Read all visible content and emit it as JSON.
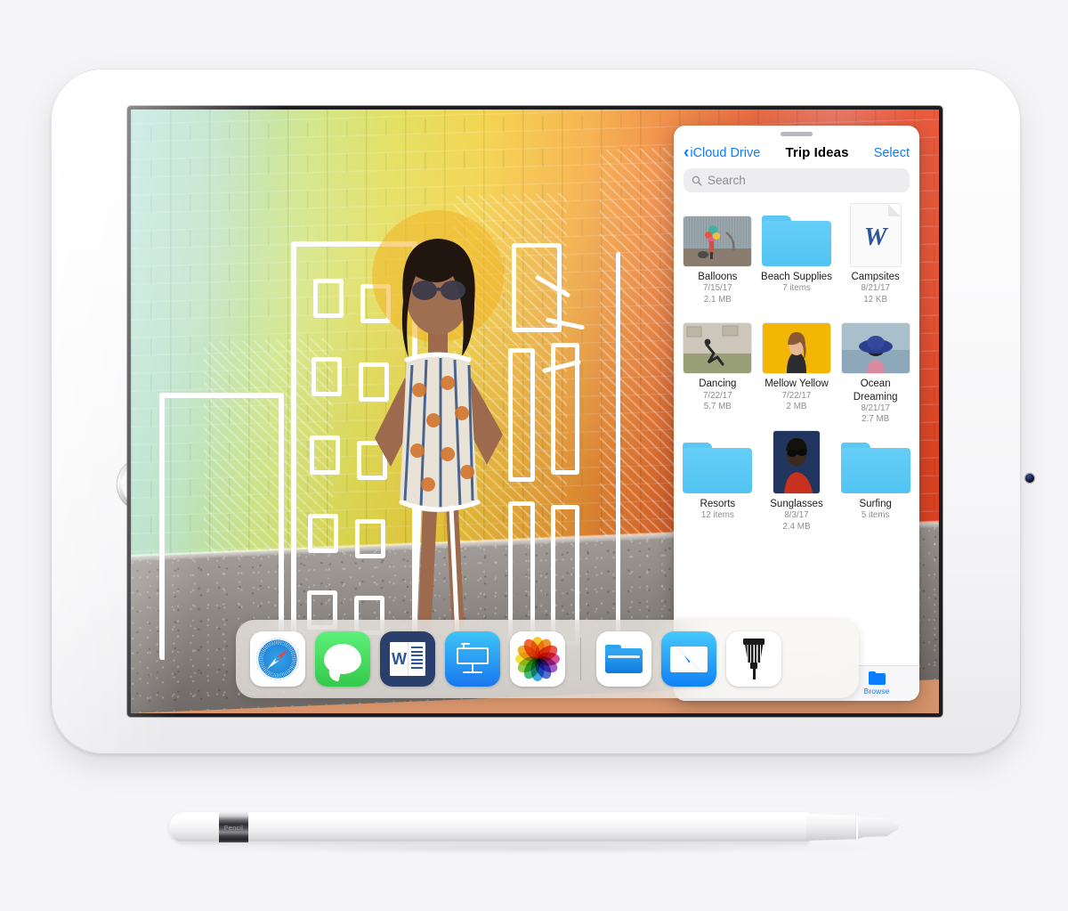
{
  "device": {
    "name": "iPad",
    "color": "Silver",
    "home_button": "home-button",
    "front_camera": "front-camera",
    "accessory": "Apple Pencil",
    "pencil_band_text": "Pencil"
  },
  "wallpaper": {
    "description": "Painted brick wall mural with white marker city drawing and woman standing",
    "gradient": [
      "#9fd9cf",
      "#cfe47f",
      "#f2cf3a",
      "#f5a93a",
      "#ef7d33",
      "#e8592c",
      "#e0421f"
    ],
    "ground_color": "#89837f",
    "marker_color": "#ffffff"
  },
  "files_app": {
    "back_label": "iCloud Drive",
    "back_icon": "chevron-left-icon",
    "title": "Trip Ideas",
    "select_label": "Select",
    "accent_color": "#0a7cff",
    "search": {
      "placeholder": "Search",
      "icon": "search-icon"
    },
    "items": [
      {
        "name": "Balloons",
        "kind": "photo",
        "date": "7/15/17",
        "size": "2.1 MB",
        "meta2": ""
      },
      {
        "name": "Beach Supplies",
        "kind": "folder",
        "date": "",
        "size": "",
        "meta2": "7 items"
      },
      {
        "name": "Campsites",
        "kind": "doc",
        "date": "8/21/17",
        "size": "12 KB",
        "meta2": "",
        "glyph": "W"
      },
      {
        "name": "Dancing",
        "kind": "photo",
        "date": "7/22/17",
        "size": "5.7 MB",
        "meta2": ""
      },
      {
        "name": "Mellow Yellow",
        "kind": "photo",
        "date": "7/22/17",
        "size": "2 MB",
        "meta2": ""
      },
      {
        "name": "Ocean Dreaming",
        "kind": "photo",
        "date": "8/21/17",
        "size": "2.7 MB",
        "meta2": ""
      },
      {
        "name": "Resorts",
        "kind": "folder",
        "date": "",
        "size": "",
        "meta2": "12 items"
      },
      {
        "name": "Sunglasses",
        "kind": "photo",
        "date": "8/3/17",
        "size": "2.4 MB",
        "meta2": ""
      },
      {
        "name": "Surfing",
        "kind": "folder",
        "date": "",
        "size": "",
        "meta2": "5 items"
      }
    ],
    "tabbar": {
      "browse_label": "Browse",
      "browse_icon": "folder-icon"
    }
  },
  "dock": {
    "apps": [
      {
        "label": "Safari",
        "icon": "safari-icon"
      },
      {
        "label": "Messages",
        "icon": "messages-icon"
      },
      {
        "label": "Word",
        "icon": "word-icon"
      },
      {
        "label": "Keynote",
        "icon": "keynote-icon"
      },
      {
        "label": "Photos",
        "icon": "photos-icon"
      }
    ],
    "recent_apps": [
      {
        "label": "Files",
        "icon": "files-icon"
      },
      {
        "label": "Mail",
        "icon": "mail-icon"
      },
      {
        "label": "Tool",
        "icon": "screwdriver-icon"
      }
    ]
  }
}
